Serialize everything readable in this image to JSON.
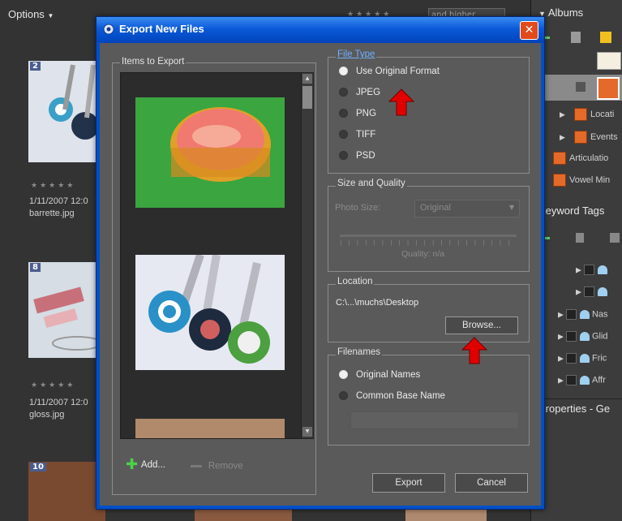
{
  "organizer": {
    "options_label": "Options",
    "rating_filter": "and higher",
    "thumbnails": [
      {
        "number": "2",
        "date": "1/11/2007 12:0",
        "filename": "barrette.jpg"
      },
      {
        "number": "8",
        "date": "1/11/2007 12:0",
        "filename": "gloss.jpg"
      },
      {
        "number": "10"
      }
    ],
    "stars": "★★★★★"
  },
  "right_panel": {
    "albums_header": "Albums",
    "album_rows": [
      "Locati",
      "Events",
      "Articulatio",
      "Vowel Min"
    ],
    "keyword_tags_header": "Keyword Tags",
    "tag_rows": [
      "Nas",
      "Glid",
      "Fric",
      "Affr"
    ],
    "properties_header": "Properties - Ge"
  },
  "dialog": {
    "title": "Export New Files",
    "close_label": "✕",
    "items_to_export": {
      "label": "Items to Export",
      "add_label": "Add...",
      "remove_label": "Remove"
    },
    "file_type": {
      "label": "File Type",
      "options": [
        "Use Original Format",
        "JPEG",
        "PNG",
        "TIFF",
        "PSD"
      ],
      "selected": "Use Original Format"
    },
    "size_quality": {
      "label": "Size and Quality",
      "photo_size_label": "Photo Size:",
      "photo_size_value": "Original",
      "quality_label": "Quality: n/a"
    },
    "location": {
      "label": "Location",
      "path": "C:\\...\\muchs\\Desktop",
      "browse_label": "Browse..."
    },
    "filenames": {
      "label": "Filenames",
      "options": [
        "Original Names",
        "Common Base Name"
      ],
      "selected": "Original Names",
      "base_name_value": ""
    },
    "export_label": "Export",
    "cancel_label": "Cancel"
  },
  "colors": {
    "titlebar": "#0a5ad8",
    "dialog_body": "#5a5a5a",
    "annotation_arrow": "#e00000",
    "close_button": "#e04a1c"
  }
}
